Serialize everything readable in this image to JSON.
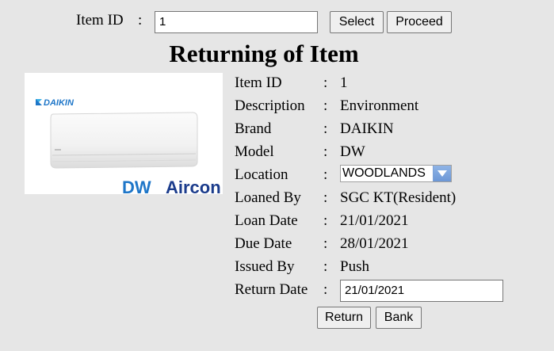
{
  "search": {
    "label": "Item ID",
    "colon": ":",
    "value": "1",
    "select_label": "Select",
    "proceed_label": "Proceed"
  },
  "page_title": "Returning of Item",
  "image": {
    "brand_logo": "DAIKIN",
    "shop_logo_dw": "DW",
    "shop_logo_aircon": "Aircon",
    "icon": "air-conditioner-product-photo"
  },
  "details": {
    "colon": ":",
    "rows": [
      {
        "label": "Item ID",
        "value": "1"
      },
      {
        "label": "Description",
        "value": "Environment"
      },
      {
        "label": "Brand",
        "value": "DAIKIN"
      },
      {
        "label": "Model",
        "value": "DW"
      },
      {
        "label": "Location",
        "value": "WOODLANDS"
      },
      {
        "label": "Loaned By",
        "value": "SGC KT(Resident)"
      },
      {
        "label": "Loan Date",
        "value": "21/01/2021"
      },
      {
        "label": "Due Date",
        "value": "28/01/2021"
      },
      {
        "label": "Issued By",
        "value": "Push"
      },
      {
        "label": "Return Date",
        "value": "21/01/2021"
      }
    ]
  },
  "actions": {
    "return_label": "Return",
    "bank_label": "Bank"
  },
  "colors": {
    "background": "#e6e6e6",
    "daikin_blue": "#1e76c8",
    "aircon_navy": "#1b3c8c",
    "dropdown_arrow": "#6c97d6"
  }
}
